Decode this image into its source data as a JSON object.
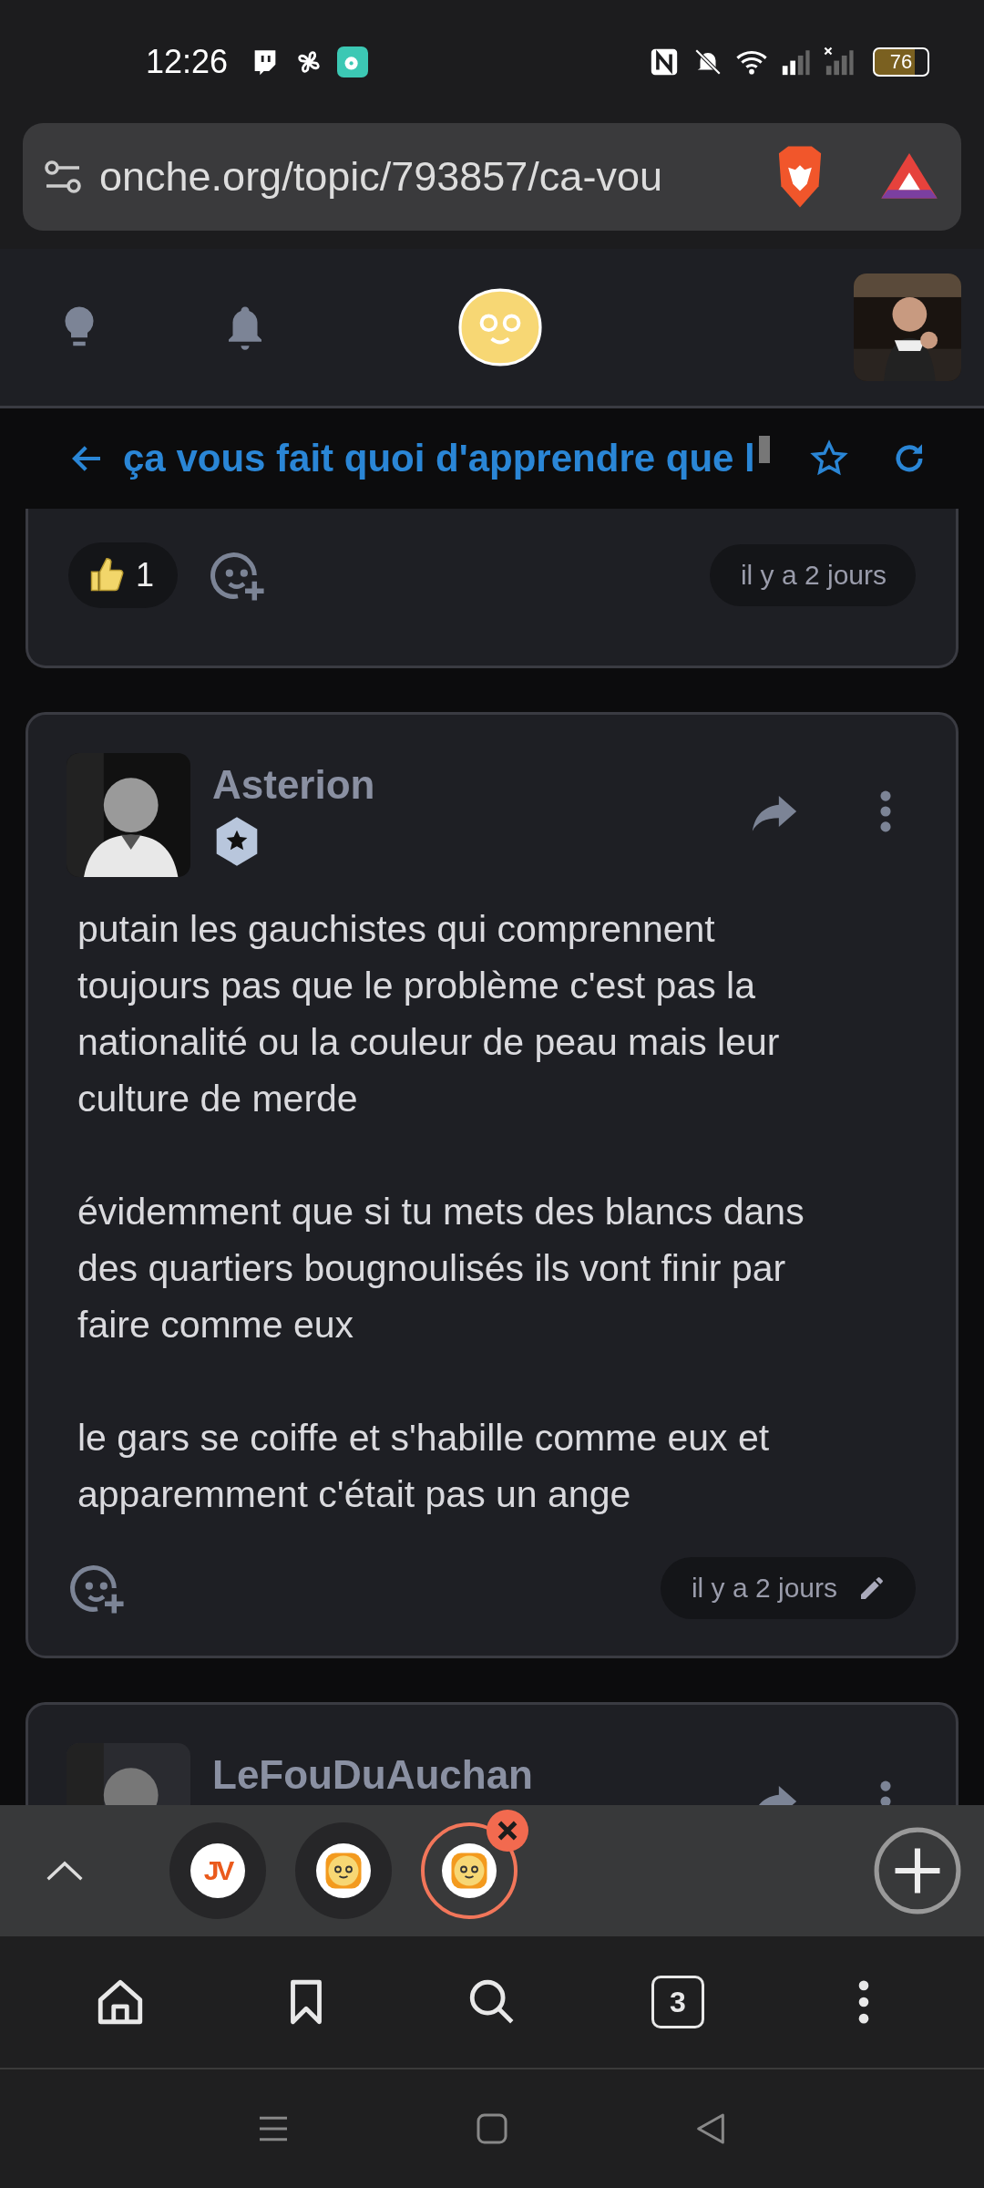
{
  "status_bar": {
    "time": "12:26",
    "battery": "76"
  },
  "address_bar": {
    "url": "onche.org/topic/793857/ca-vou"
  },
  "topic": {
    "title": "ça vous fait quoi d'apprendre que l",
    "favorited": false
  },
  "posts": [
    {
      "kind": "partial",
      "reactions": [
        {
          "count": "1"
        }
      ],
      "time": "il y a 2 jours",
      "edited": false
    },
    {
      "kind": "full",
      "author": "Asterion",
      "paragraphs": [
        "putain les gauchistes qui comprennent toujours pas que le problème c'est pas la nationalité ou la couleur de peau mais leur culture de merde",
        "évidemment que si tu mets des blancs dans des quartiers bougnoulisés ils vont finir par faire comme eux",
        "le gars se coiffe et s'habille comme eux et apparemment c'était pas un ange"
      ],
      "time": "il y a 2 jours",
      "edited": true
    },
    {
      "kind": "cut",
      "author": "LeFouDuAuchan"
    }
  ],
  "tabs": [
    {
      "kind": "letters",
      "label": "JV",
      "selected": false
    },
    {
      "kind": "smiley",
      "selected": false
    },
    {
      "kind": "smiley",
      "selected": true
    }
  ],
  "toolbar": {
    "tab_count": "3"
  }
}
